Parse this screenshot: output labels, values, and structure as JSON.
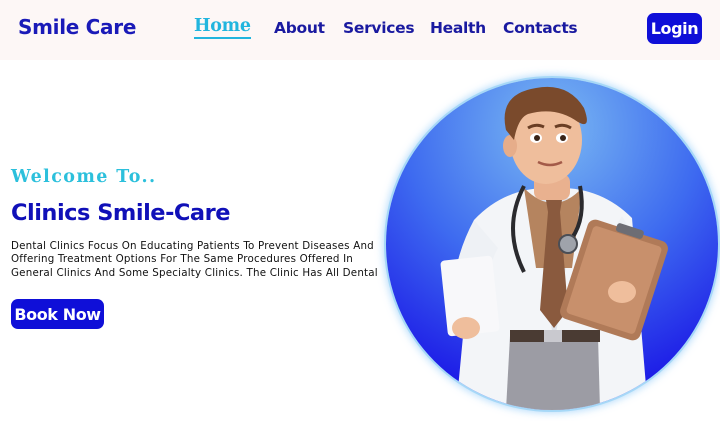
{
  "header": {
    "brand": "Smile Care",
    "nav": [
      {
        "label": "Home",
        "active": true
      },
      {
        "label": "About"
      },
      {
        "label": "Services"
      },
      {
        "label": "Health"
      },
      {
        "label": "Contacts"
      }
    ],
    "login_label": "Login"
  },
  "hero": {
    "welcome": "Welcome To..",
    "headline": "Clinics Smile-Care",
    "description": "Dental Clinics Focus On Educating Patients To Prevent Diseases And Offering Treatment Options For The Same Procedures Offered In General Clinics And Some Specialty Clinics. The Clinic Has All Dental",
    "book_label": "Book Now",
    "image": "doctor-illustration"
  },
  "colors": {
    "primary": "#0f0fd8",
    "accent": "#21b5de",
    "nav_bg": "#fdf7f6",
    "text": "#1a1aa0"
  }
}
